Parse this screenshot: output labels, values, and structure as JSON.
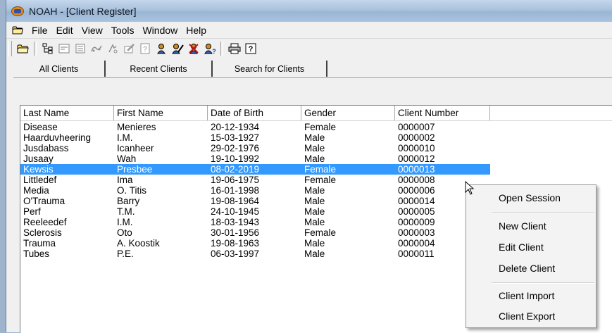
{
  "window": {
    "title": "NOAH - [Client Register]"
  },
  "menubar": {
    "items": [
      "File",
      "Edit",
      "View",
      "Tools",
      "Window",
      "Help"
    ]
  },
  "toolbar": {
    "buttons": [
      "open-folder-icon",
      "tree-view-icon",
      "form-view-icon",
      "card-view-icon",
      "hearing-measure-icon",
      "fitting-icon",
      "edit-journal-icon",
      "help-question-icon",
      "new-client-icon",
      "edit-client-icon",
      "delete-client-icon",
      "find-client-icon",
      "print-icon",
      "help-icon"
    ]
  },
  "tabs": [
    "All Clients",
    "Recent Clients",
    "Search for Clients"
  ],
  "table": {
    "columns": [
      "Last Name",
      "First Name",
      "Date of Birth",
      "Gender",
      "Client Number"
    ],
    "selected_index": 4,
    "rows": [
      [
        "Disease",
        "Menieres",
        "20-12-1934",
        "Female",
        "0000007"
      ],
      [
        "Haarduvheering",
        "I.M.",
        "15-03-1927",
        "Male",
        "0000002"
      ],
      [
        "Jusdabass",
        "Icanheer",
        "29-02-1976",
        "Male",
        "0000010"
      ],
      [
        "Jusaay",
        "Wah",
        "19-10-1992",
        "Male",
        "0000012"
      ],
      [
        "Kewsis",
        "Presbee",
        "08-02-2019",
        "Female",
        "0000013"
      ],
      [
        "Littledef",
        "Ima",
        "19-06-1975",
        "Female",
        "0000008"
      ],
      [
        "Media",
        "O. Titis",
        "16-01-1998",
        "Male",
        "0000006"
      ],
      [
        "O'Trauma",
        "Barry",
        "19-08-1964",
        "Male",
        "0000014"
      ],
      [
        "Perf",
        "T.M.",
        "24-10-1945",
        "Male",
        "0000005"
      ],
      [
        "Reeleedef",
        "I.M.",
        "18-03-1943",
        "Male",
        "0000009"
      ],
      [
        "Sclerosis",
        "Oto",
        "30-01-1956",
        "Female",
        "0000003"
      ],
      [
        "Trauma",
        "A. Koostik",
        "19-08-1963",
        "Male",
        "0000004"
      ],
      [
        "Tubes",
        "P.E.",
        "06-03-1997",
        "Male",
        "0000011"
      ]
    ]
  },
  "context_menu": {
    "items": [
      "Open Session",
      "New Client",
      "Edit Client",
      "Delete Client",
      "Client Import",
      "Client Export"
    ]
  },
  "colors": {
    "selection": "#3399ff",
    "titlebar": "#a9c2de"
  }
}
